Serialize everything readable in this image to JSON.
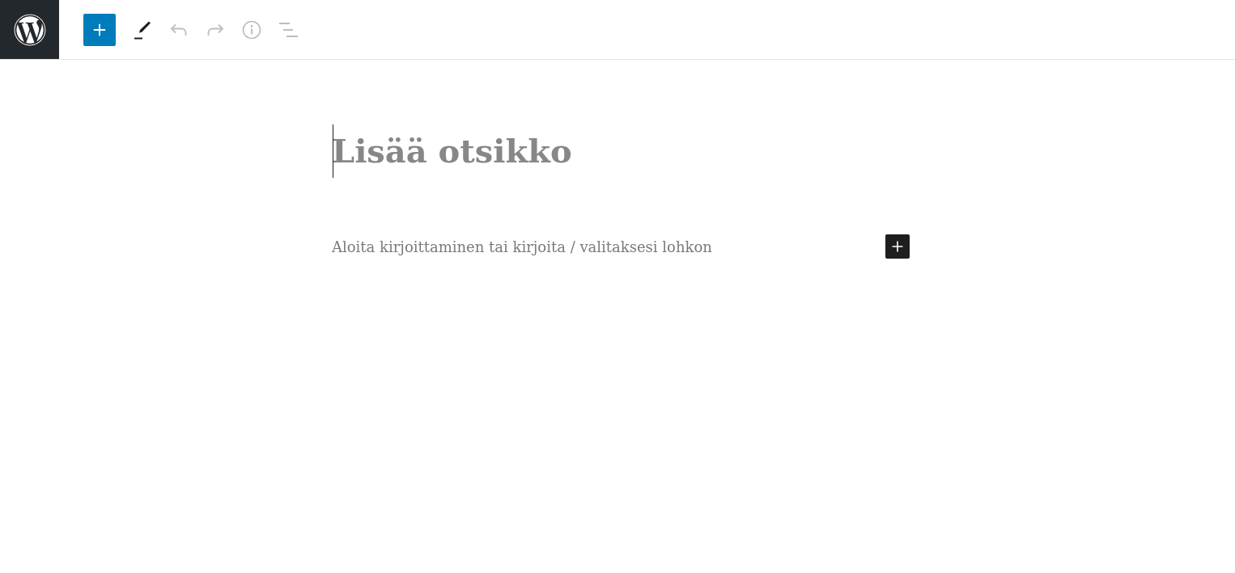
{
  "toolbar": {
    "tools": [
      {
        "kind": "inserter",
        "disabled": false
      },
      {
        "kind": "tools",
        "disabled": false
      },
      {
        "kind": "undo",
        "disabled": true
      },
      {
        "kind": "redo",
        "disabled": true
      },
      {
        "kind": "details",
        "disabled": true
      },
      {
        "kind": "list_view",
        "disabled": true
      }
    ]
  },
  "editor": {
    "title": {
      "placeholder": "Lisää otsikko",
      "focused": true
    },
    "paragraph": {
      "placeholder": "Aloita kirjoittaminen tai kirjoita / valitaksesi lohkon"
    },
    "block_inserter": {
      "kind": "inserter"
    }
  }
}
